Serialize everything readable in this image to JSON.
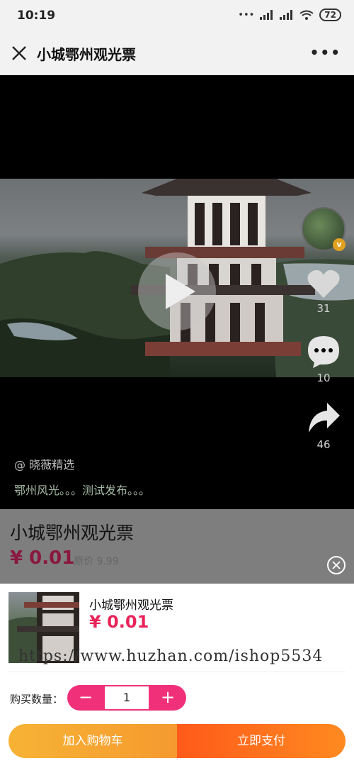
{
  "status": {
    "time": "10:19",
    "battery": "72"
  },
  "nav": {
    "title": "小城鄂州观光票",
    "more": "•••"
  },
  "video": {
    "author": "@ 晓薇精选",
    "caption": "鄂州风光。。。测试发布。。。",
    "likes": "31",
    "comments": "10",
    "shares": "46",
    "avatar_badge": "v"
  },
  "product": {
    "title": "小城鄂州观光票",
    "price": "¥ 0.01",
    "orig_price": "原价 9.99"
  },
  "sheet": {
    "name": "小城鄂州观光票",
    "price": "¥ 0.01",
    "watermark": "https://www.huzhan.com/ishop5534",
    "qty_label": "购买数量：",
    "qty_value": "1",
    "minus": "−",
    "plus": "+",
    "add_cart": "加入购物车",
    "pay_now": "立即支付"
  },
  "colors": {
    "accent": "#f0317a",
    "price": "#e8245a",
    "cart": "#f7b335",
    "pay": "#ff5a1a"
  }
}
